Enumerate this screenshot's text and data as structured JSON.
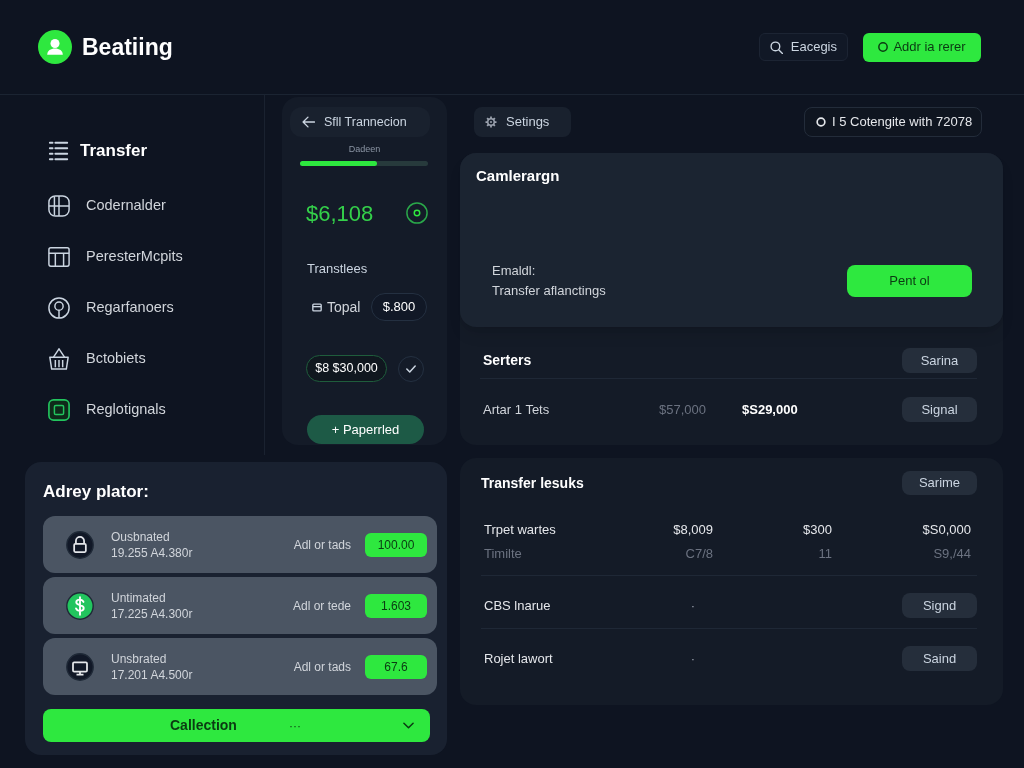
{
  "header": {
    "app_title": "Beatiing",
    "search_button": "Eacegis",
    "primary_button": "Addr ia rerer"
  },
  "sidebar": {
    "items": [
      {
        "label": "Transfer",
        "selected": true,
        "highlighted": false
      },
      {
        "label": "Codernalder",
        "selected": false,
        "highlighted": false
      },
      {
        "label": "PeresterMcpits",
        "selected": false,
        "highlighted": false
      },
      {
        "label": "Regarfanoers",
        "selected": false,
        "highlighted": false
      },
      {
        "label": "Bctobiets",
        "selected": false,
        "highlighted": false
      },
      {
        "label": "Reglotignals",
        "selected": false,
        "highlighted": true
      }
    ]
  },
  "transaction_panel": {
    "back_title": "Sfll Trannecion",
    "progress": {
      "label": "Dadeen",
      "level": 0.6
    },
    "amount": "$6,108",
    "section_label": "Transtlees",
    "total": {
      "label": "Topal",
      "value": "$.800"
    },
    "amount_chip": "$8 $30,000",
    "add_button": "+ Paperrled"
  },
  "toolbar": {
    "settings_button": "Setings",
    "status_chip": "I 5 Cotengite with 72078"
  },
  "campaign": {
    "title": "Camlerargn",
    "lines": [
      "Emaldl:",
      "Transfer aflanctings"
    ],
    "button": "Pent ol"
  },
  "servers": {
    "title": "Serters",
    "header_button": "Sarina",
    "rows": [
      {
        "name": "Artar 1 Tets",
        "value_1": "$57,000",
        "value_2": "$S29,000",
        "button": "Signal"
      }
    ]
  },
  "transfer_results": {
    "title": "Transfer lesuks",
    "header_button": "Sarime",
    "rows": [
      {
        "kind": "values",
        "name": "Trpet wartes",
        "cells": [
          "$8,009",
          "$300",
          "$S0,000"
        ],
        "sub": {
          "name": "Timilte",
          "cells": [
            "C7/8",
            "11",
            "S9,/44"
          ]
        }
      },
      {
        "kind": "action",
        "name": "CBS lnarue",
        "cells": [
          "·"
        ],
        "button": "Signd"
      },
      {
        "kind": "action",
        "name": "Rojet lawort",
        "cells": [
          "·"
        ],
        "button": "Saind"
      }
    ]
  },
  "accounts": {
    "title": "Adrey plator:",
    "rows": [
      {
        "title": "Ousbnated",
        "subtitle": "19.255 A4.380r",
        "label": "Adl or tads",
        "badge": "100.00",
        "color": "#111827"
      },
      {
        "title": "Untimated",
        "subtitle": "17.225 A4.300r",
        "label": "Adl or tede",
        "badge": "1.603",
        "color": "#22c55e"
      },
      {
        "title": "Unsbrated",
        "subtitle": "17.201 A4.500r",
        "label": "Adl or tads",
        "badge": "67.6",
        "color": "#111827"
      }
    ],
    "button": {
      "label": "Callection",
      "extra": "···"
    }
  }
}
